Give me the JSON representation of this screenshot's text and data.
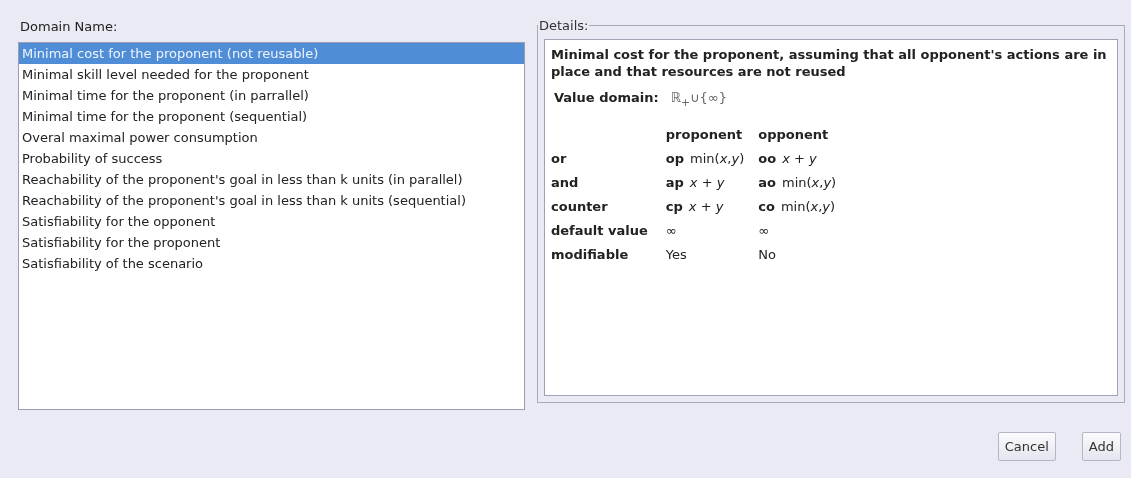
{
  "domain_label": "Domain Name:",
  "domains": [
    {
      "label": "Minimal cost for the proponent (not reusable)",
      "selected": true
    },
    {
      "label": "Minimal skill level needed for the proponent",
      "selected": false
    },
    {
      "label": "Minimal time for the proponent (in parrallel)",
      "selected": false
    },
    {
      "label": "Minimal time for the proponent (sequential)",
      "selected": false
    },
    {
      "label": "Overal maximal power consumption",
      "selected": false
    },
    {
      "label": "Probability of success",
      "selected": false
    },
    {
      "label": "Reachability of the proponent's goal in less than k units (in parallel)",
      "selected": false
    },
    {
      "label": "Reachability of the proponent's goal in less than k units (sequential)",
      "selected": false
    },
    {
      "label": "Satisfiability for the opponent",
      "selected": false
    },
    {
      "label": "Satisfiability for the proponent",
      "selected": false
    },
    {
      "label": "Satisfiability of the scenario",
      "selected": false
    }
  ],
  "details": {
    "legend": "Details:",
    "description": "Minimal cost for the proponent, assuming that all opponent's actions are in place and that resources are not reused",
    "value_domain_label": "Value domain:",
    "value_domain": "ℝ$_{+}$∪{∞}",
    "columns": [
      "proponent",
      "opponent"
    ],
    "rows": [
      {
        "label": "or",
        "proponent_code": "op",
        "proponent_value": "min(*x*,*y*)",
        "opponent_code": "oo",
        "opponent_value": "*x* + *y*"
      },
      {
        "label": "and",
        "proponent_code": "ap",
        "proponent_value": "*x* + *y*",
        "opponent_code": "ao",
        "opponent_value": "min(*x*,*y*)"
      },
      {
        "label": "counter",
        "proponent_code": "cp",
        "proponent_value": "*x* + *y*",
        "opponent_code": "co",
        "opponent_value": "min(*x*,*y*)"
      },
      {
        "label": "default value",
        "proponent_value": "∞",
        "opponent_value": "∞"
      },
      {
        "label": "modifiable",
        "proponent_value": "Yes",
        "opponent_value": "No"
      }
    ]
  },
  "buttons": [
    "Cancel",
    "Add"
  ]
}
